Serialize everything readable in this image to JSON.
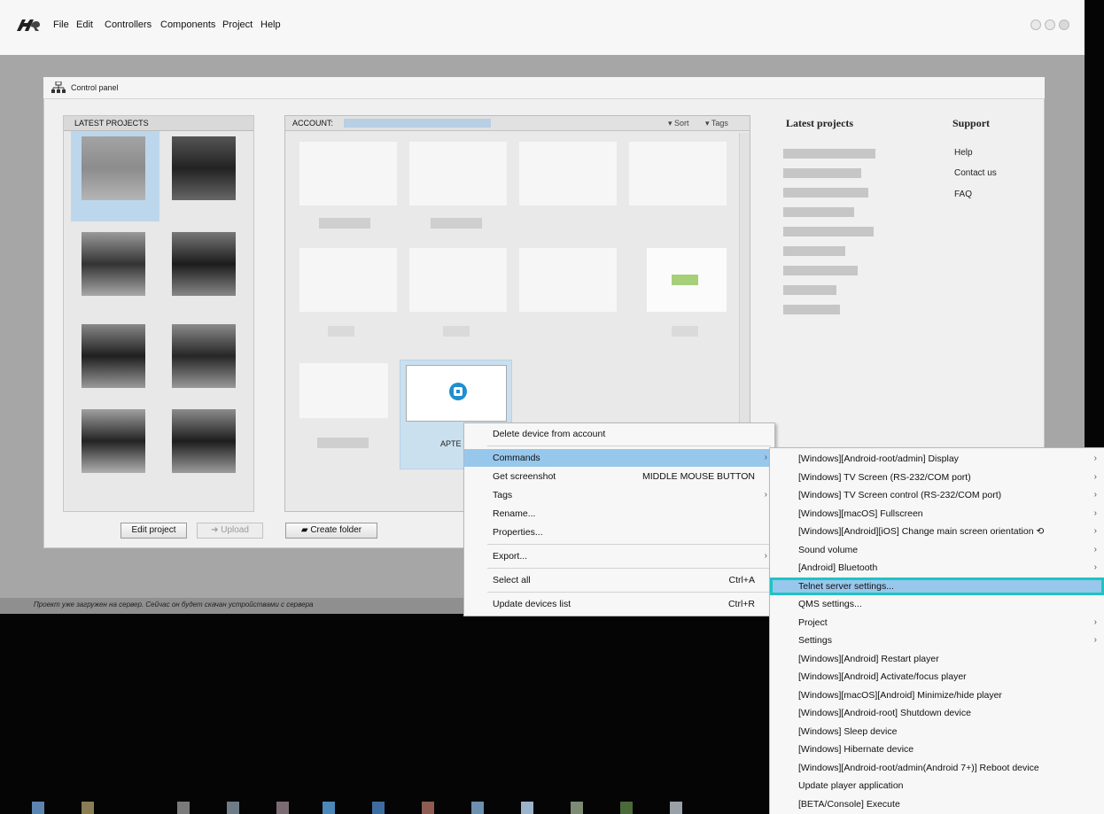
{
  "menubar": {
    "logo_name": "app-logo",
    "items": [
      "File",
      "Edit",
      "Controllers",
      "Components",
      "Project",
      "Help"
    ]
  },
  "control_panel": {
    "title": "Control panel",
    "latest_projects_title": "LATEST PROJECTS",
    "account_label": "ACCOUNT:",
    "sort_label": "▾ Sort",
    "tags_label": "▾ Tags",
    "selected_device_label": "APTE",
    "buttons": {
      "edit_project": "Edit project",
      "upload": "Upload",
      "create_folder": "Create folder"
    },
    "right": {
      "latest_projects": "Latest projects",
      "support": "Support",
      "support_links": [
        "Help",
        "Contact us",
        "FAQ"
      ]
    }
  },
  "status_text": "Проект уже загружен на сервер. Сейчас он будет скачан устройствами с сервера",
  "context_menu": {
    "items": [
      {
        "label": "Delete device from account",
        "shortcut": "",
        "submenu": false
      },
      {
        "label": "Commands",
        "shortcut": "",
        "submenu": true,
        "highlighted": true
      },
      {
        "label": "Get screenshot",
        "shortcut": "MIDDLE MOUSE BUTTON",
        "submenu": false
      },
      {
        "label": "Tags",
        "shortcut": "",
        "submenu": true
      },
      {
        "label": "Rename...",
        "shortcut": "",
        "submenu": false
      },
      {
        "label": "Properties...",
        "shortcut": "",
        "submenu": false
      },
      {
        "label": "Export...",
        "shortcut": "",
        "submenu": true
      },
      {
        "label": "Select all",
        "shortcut": "Ctrl+A",
        "submenu": false
      },
      {
        "label": "Update devices list",
        "shortcut": "Ctrl+R",
        "submenu": false
      }
    ]
  },
  "commands_menu": {
    "items": [
      {
        "label": "[Windows][Android-root/admin] Display",
        "submenu": true
      },
      {
        "label": "[Windows] TV Screen (RS-232/COM port)",
        "submenu": true
      },
      {
        "label": "[Windows] TV Screen control (RS-232/COM port)",
        "submenu": true
      },
      {
        "label": "[Windows][macOS] Fullscreen",
        "submenu": true
      },
      {
        "label": "[Windows][Android][iOS] Change main screen orientation ⟲",
        "submenu": true
      },
      {
        "label": "Sound volume",
        "submenu": true
      },
      {
        "label": "[Android] Bluetooth",
        "submenu": true
      },
      {
        "label": "Telnet server settings...",
        "submenu": false,
        "highlighted": true
      },
      {
        "label": "QMS settings...",
        "submenu": false
      },
      {
        "label": "Project",
        "submenu": true
      },
      {
        "label": "Settings",
        "submenu": true
      },
      {
        "label": "[Windows][Android] Restart player",
        "submenu": false
      },
      {
        "label": "[Windows][Android] Activate/focus player",
        "submenu": false
      },
      {
        "label": "[Windows][macOS][Android] Minimize/hide player",
        "submenu": false
      },
      {
        "label": "[Windows][Android-root] Shutdown device",
        "submenu": false
      },
      {
        "label": "[Windows] Sleep device",
        "submenu": false
      },
      {
        "label": "[Windows] Hibernate device",
        "submenu": false
      },
      {
        "label": "[Windows][Android-root/admin(Android 7+)] Reboot device",
        "submenu": false
      },
      {
        "label": "Update player application",
        "submenu": false
      },
      {
        "label": "[BETA/Console] Execute",
        "submenu": false
      }
    ]
  },
  "colors": {
    "highlight": "#98c7ec",
    "focus_outline": "#1fc3c4",
    "device_icon": "#1e8fd0"
  }
}
